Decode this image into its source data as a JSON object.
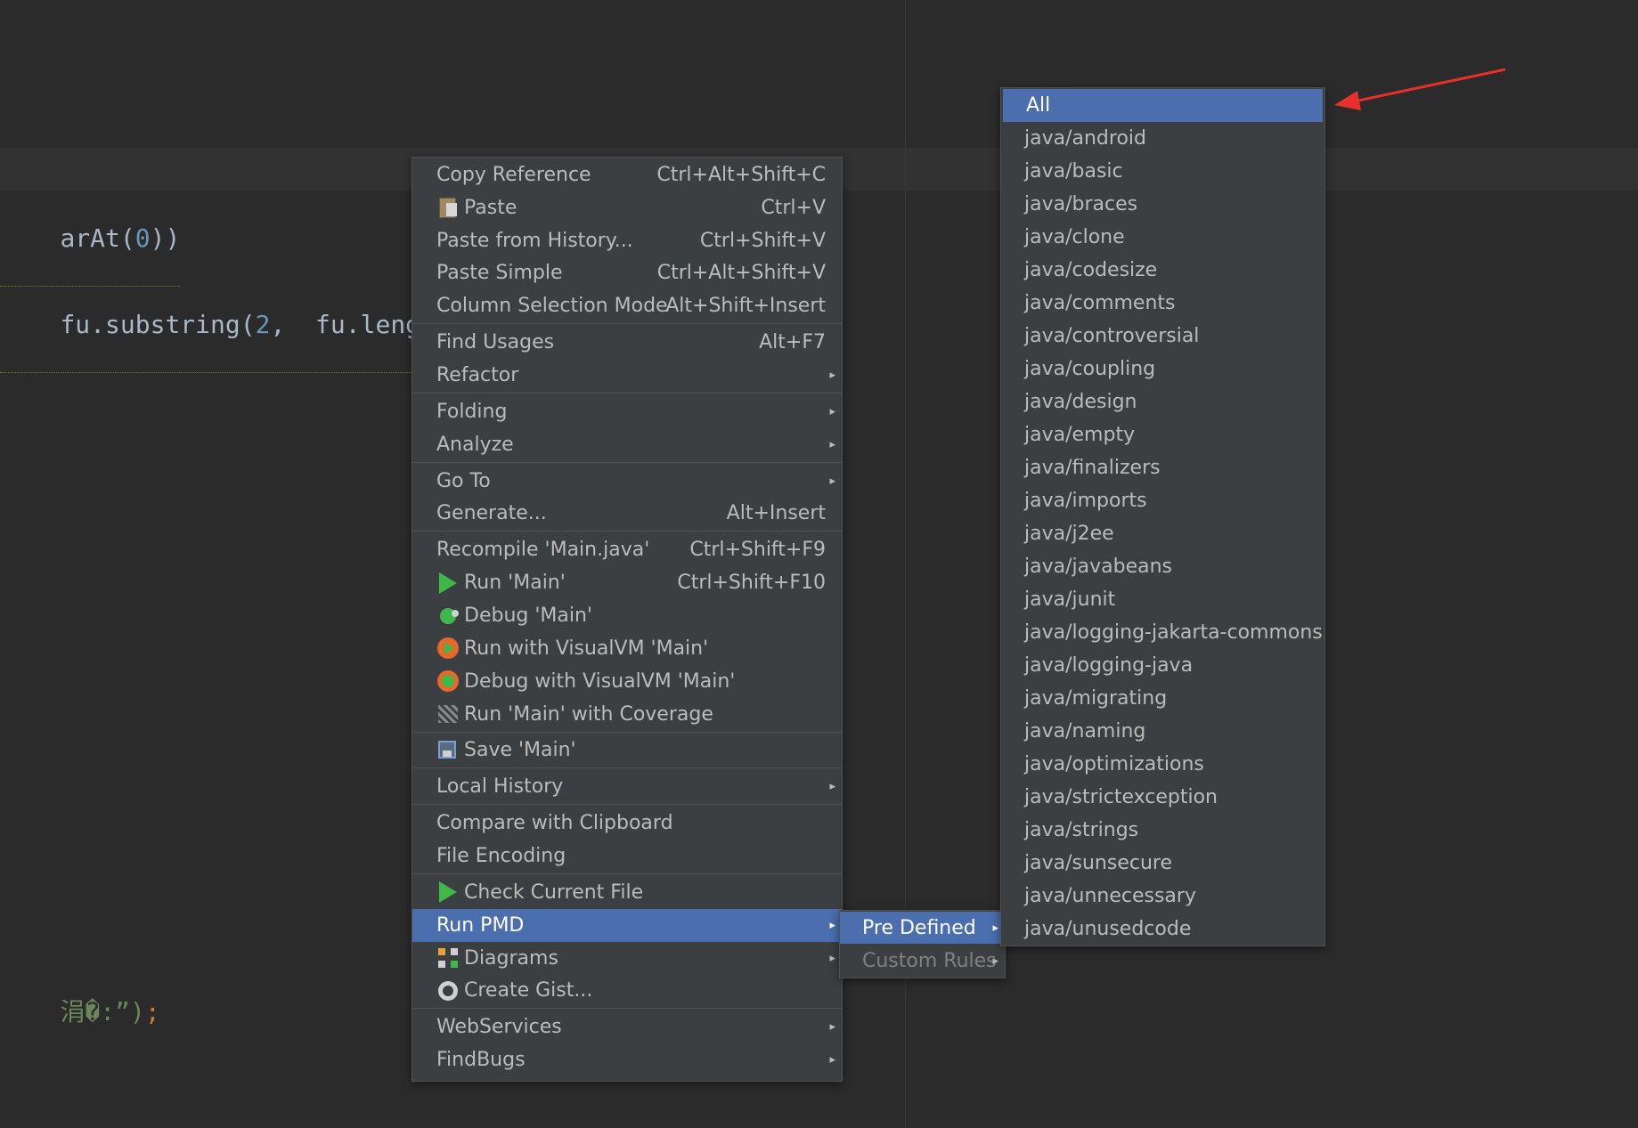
{
  "editor": {
    "code_line1": {
      "a": "arAt",
      "b": "(",
      "n": "0",
      "c": "))"
    },
    "code_line2": {
      "a": "fu.substring(",
      "n": "2",
      "b": ",  fu.length()))",
      "s": ";"
    },
    "code_line3": {
      "s": "涓�:”)",
      "semi": ";"
    }
  },
  "context_menu": {
    "groups": [
      [
        {
          "label": "Copy Reference",
          "shortcut": "Ctrl+Alt+Shift+C"
        },
        {
          "label": "Paste",
          "shortcut": "Ctrl+V",
          "icon": "clipboard-icon"
        },
        {
          "label": "Paste from History...",
          "shortcut": "Ctrl+Shift+V"
        },
        {
          "label": "Paste Simple",
          "shortcut": "Ctrl+Alt+Shift+V"
        },
        {
          "label": "Column Selection Mode",
          "shortcut": "Alt+Shift+Insert"
        }
      ],
      [
        {
          "label": "Find Usages",
          "shortcut": "Alt+F7"
        },
        {
          "label": "Refactor",
          "submenu": true
        }
      ],
      [
        {
          "label": "Folding",
          "submenu": true
        },
        {
          "label": "Analyze",
          "submenu": true
        }
      ],
      [
        {
          "label": "Go To",
          "submenu": true
        },
        {
          "label": "Generate...",
          "shortcut": "Alt+Insert"
        }
      ],
      [
        {
          "label": "Recompile 'Main.java'",
          "shortcut": "Ctrl+Shift+F9"
        },
        {
          "label": "Run 'Main'",
          "shortcut": "Ctrl+Shift+F10",
          "icon": "run-icon"
        },
        {
          "label": "Debug 'Main'",
          "icon": "debug-icon"
        },
        {
          "label": "Run with VisualVM 'Main'",
          "icon": "visualvm-run-icon"
        },
        {
          "label": "Debug with VisualVM 'Main'",
          "icon": "visualvm-debug-icon"
        },
        {
          "label": "Run 'Main' with Coverage",
          "icon": "coverage-icon"
        }
      ],
      [
        {
          "label": "Save 'Main'",
          "icon": "save-icon"
        }
      ],
      [
        {
          "label": "Local History",
          "submenu": true
        }
      ],
      [
        {
          "label": "Compare with Clipboard"
        },
        {
          "label": "File Encoding"
        }
      ],
      [
        {
          "label": "Check Current File",
          "icon": "run-icon"
        },
        {
          "label": "Run PMD",
          "submenu": true,
          "selected": true
        },
        {
          "label": "Diagrams",
          "submenu": true,
          "icon": "diagrams-icon"
        },
        {
          "label": "Create Gist...",
          "icon": "github-icon"
        }
      ],
      [
        {
          "label": "WebServices",
          "submenu": true
        },
        {
          "label": "FindBugs",
          "submenu": true
        }
      ]
    ]
  },
  "pmd_submenu": {
    "items": [
      {
        "label": "Pre Defined",
        "selected": true
      },
      {
        "label": "Custom Rules",
        "disabled": true
      }
    ]
  },
  "rules_submenu": {
    "items": [
      "All",
      "java/android",
      "java/basic",
      "java/braces",
      "java/clone",
      "java/codesize",
      "java/comments",
      "java/controversial",
      "java/coupling",
      "java/design",
      "java/empty",
      "java/finalizers",
      "java/imports",
      "java/j2ee",
      "java/javabeans",
      "java/junit",
      "java/logging-jakarta-commons",
      "java/logging-java",
      "java/migrating",
      "java/naming",
      "java/optimizations",
      "java/strictexception",
      "java/strings",
      "java/sunsecure",
      "java/unnecessary",
      "java/unusedcode"
    ],
    "selected_index": 0
  },
  "colors": {
    "menu_bg": "#3c3f41",
    "selection": "#4b6eaf",
    "annotation_arrow": "#e8302a"
  }
}
